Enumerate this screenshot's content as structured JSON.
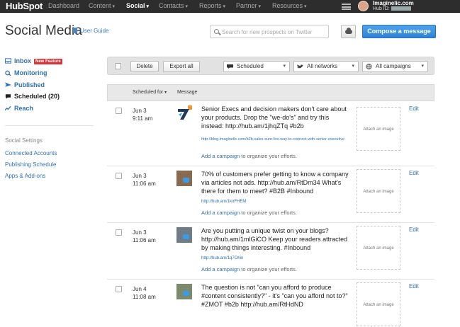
{
  "topnav": {
    "logo": "HubSpot",
    "items": [
      "Dashboard",
      "Content",
      "Social",
      "Contacts",
      "Reports",
      "Partner",
      "Resources"
    ],
    "account_name": "Imaginelic.com",
    "hub_label": "Hub ID:"
  },
  "header": {
    "title": "Social Media",
    "user_guide": "User Guide",
    "search_placeholder": "Search for new prospects on Twitter",
    "compose": "Compose a message"
  },
  "sidebar": {
    "items": [
      {
        "label": "Inbox",
        "badge": "New Feature"
      },
      {
        "label": "Monitoring"
      },
      {
        "label": "Published"
      },
      {
        "label": "Scheduled (20)"
      },
      {
        "label": "Reach"
      }
    ],
    "settings_title": "Social Settings",
    "settings_links": [
      "Connected Accounts",
      "Publishing Schedule",
      "Apps & Add-ons"
    ]
  },
  "toolbar": {
    "delete": "Delete",
    "export": "Export all",
    "filter_status": "Scheduled",
    "filter_networks": "All networks",
    "filter_campaigns": "All campaigns"
  },
  "table": {
    "col_scheduled": "Scheduled for",
    "col_message": "Message",
    "attach_label": "Attach an image",
    "edit_label": "Edit",
    "add_campaign_link": "Add a campaign",
    "add_campaign_suffix": " to organize your efforts.",
    "rows": [
      {
        "date": "Jun 3",
        "time": "9:11 am",
        "message": "Senior Execs and decision makers don't care about your products. Drop the \"we-do's\" and try this instead: http://hub.am/1jhqZTq #b2b",
        "link": "http://blog.imaginellc.com/b2b-sales-sure-fire-way-to-connect-with-senior-executive"
      },
      {
        "date": "Jun 3",
        "time": "11:06 am",
        "message": "70% of customers prefer getting to know a company via articles not ads. http://hub.am/RtDm34 What's there for them to meet? #B2B #Inbound",
        "link": "http://hub.am/1koFHEM"
      },
      {
        "date": "Jun 3",
        "time": "11:06 am",
        "message": "Are you putting a unique twist on your blogs? http://hub.am/1mlGiCO Keep your readers attracted by making things interesting. #Inbound",
        "link": "http://hub.am/1q7Ohin"
      },
      {
        "date": "Jun 4",
        "time": "11:08 am",
        "message": "The question is not \"can you afford to produce #content consistently?\" - it's \"can you afford not to?\" #ZMOT #b2b http://hub.am/RtHdND",
        "link": ""
      }
    ]
  },
  "colors": {
    "nav_bg": "#2d2d2d",
    "accent_blue": "#2f6fb5",
    "compose_blue": "#3a8ee6",
    "badge_red": "#d6333a",
    "hubspot_orange": "#f57722"
  }
}
